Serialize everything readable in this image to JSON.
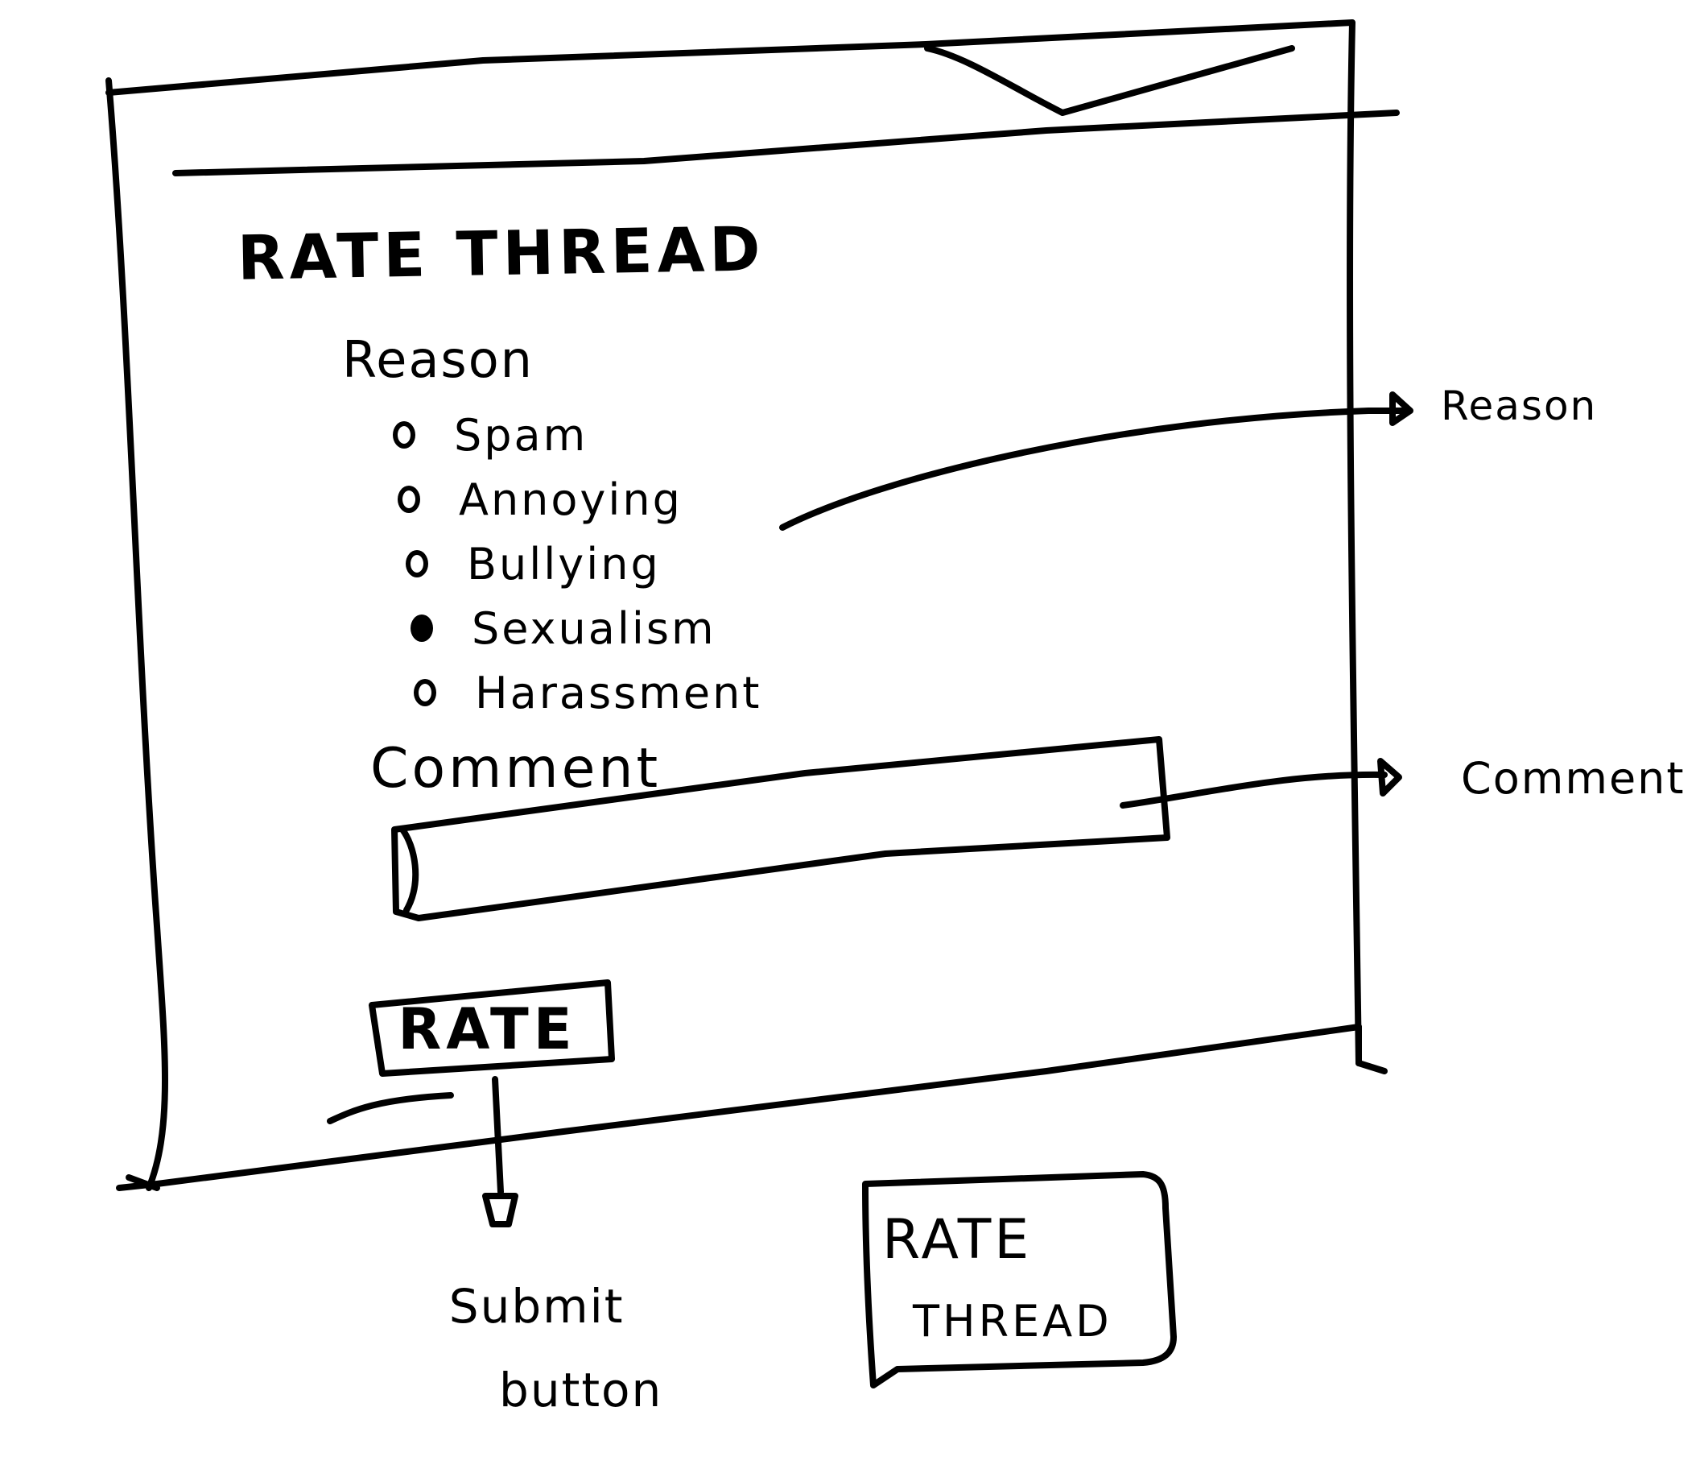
{
  "dialog": {
    "title": "RATE THREAD",
    "reason_label": "Reason",
    "reason_options": [
      {
        "label": "Spam",
        "selected": false
      },
      {
        "label": "Annoying",
        "selected": false
      },
      {
        "label": "Bullying",
        "selected": false
      },
      {
        "label": "Sexualism",
        "selected": true
      },
      {
        "label": "Harassment",
        "selected": false
      }
    ],
    "comment_label": "Comment",
    "comment_value": "",
    "comment_placeholder": "",
    "submit_label": "RATE"
  },
  "annotations": {
    "reason": "Reason",
    "comment": "Comment",
    "submit_line1": "Submit",
    "submit_line2": "button"
  },
  "legend": {
    "line1": "RATE",
    "line2": "THREAD"
  },
  "colors": {
    "ink": "#000000",
    "paper": "#ffffff"
  }
}
